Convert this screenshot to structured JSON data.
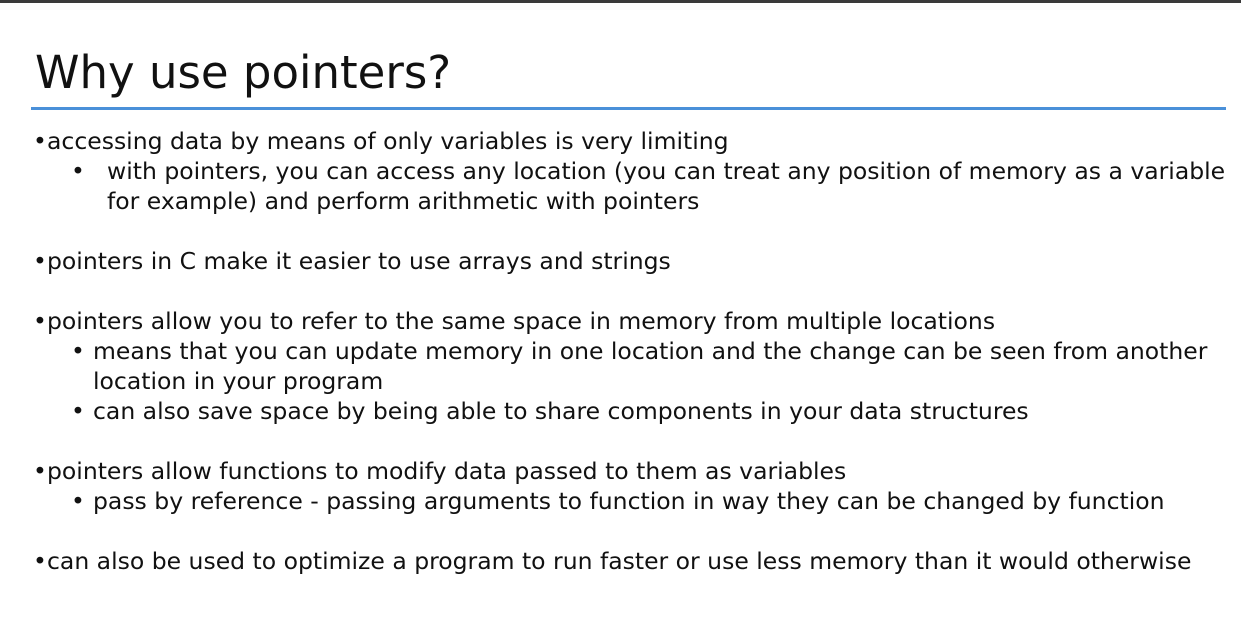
{
  "slide": {
    "title": "Why use pointers?",
    "bullets": [
      {
        "text": "accessing data by means of only variables is very limiting",
        "sub": [
          "with pointers, you can access any location (you can treat any position of memory as a variable for example) and perform arithmetic with pointers"
        ]
      },
      {
        "text": "pointers in C make it easier to use arrays and  strings",
        "sub": []
      },
      {
        "text": "pointers allow you to refer to the same space in memory from multiple locations",
        "sub": [
          "means that you can update memory in one location and the change can be seen from another location in your program",
          "can also save space by being able to share components in your data structures"
        ]
      },
      {
        "text": "pointers allow functions to modify data passed to them as variables",
        "sub": [
          "pass by reference - passing arguments to function in way they can be changed by function"
        ]
      },
      {
        "text": "can also be used to optimize a program to run faster or use less memory than it would otherwise",
        "sub": []
      }
    ]
  },
  "colors": {
    "accent_rule": "#4a90d9",
    "top_bar": "#3a3a3a",
    "text": "#111111"
  }
}
